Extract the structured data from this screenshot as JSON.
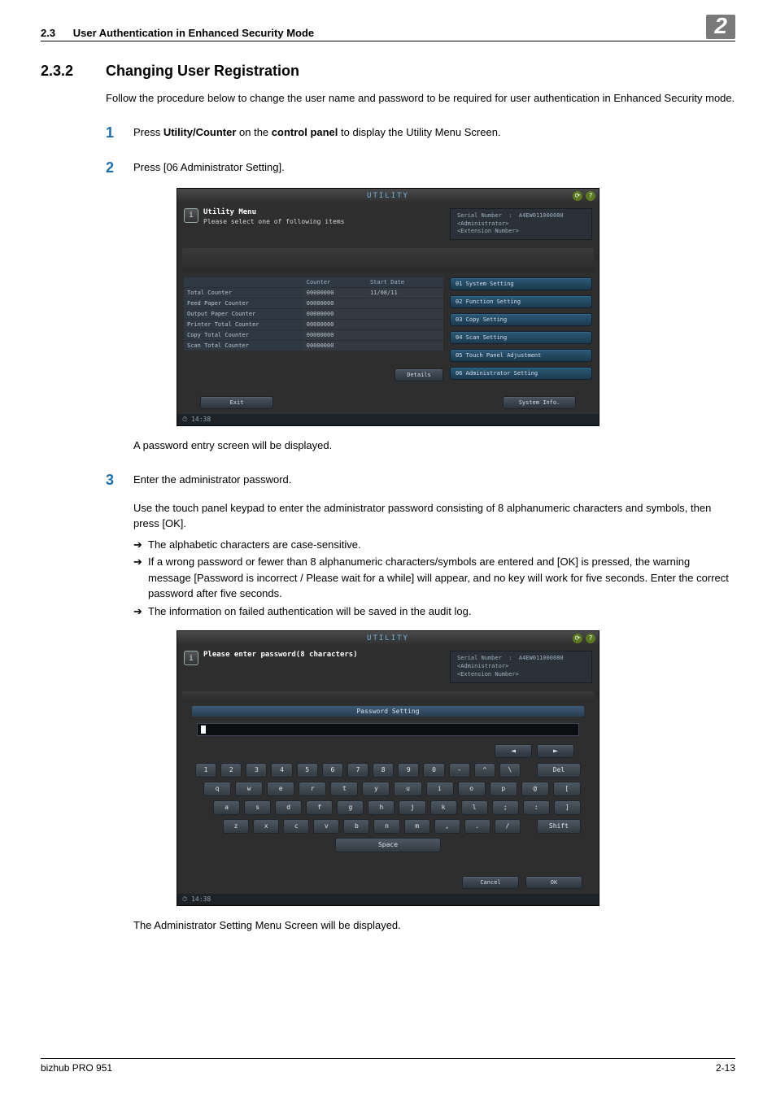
{
  "header": {
    "section_number": "2.3",
    "section_title": "User Authentication in Enhanced Security Mode",
    "chapter": "2"
  },
  "section": {
    "subnum": "2.3.2",
    "title": "Changing User Registration",
    "intro": "Follow the procedure below to change the user name and password to be required for user authentication in Enhanced Security mode."
  },
  "steps": {
    "s1": {
      "num": "1",
      "before": "Press ",
      "bold1": "Utility/Counter",
      "mid": " on the ",
      "bold2": "control panel",
      "after": " to display the Utility Menu Screen."
    },
    "s2": {
      "num": "2",
      "text": "Press [06 Administrator Setting]."
    },
    "s2_after": "A password entry screen will be displayed.",
    "s3": {
      "num": "3",
      "line1": "Enter the administrator password.",
      "para": "Use the touch panel keypad to enter the administrator password consisting of 8 alphanumeric characters and symbols, then press [OK].",
      "b1": "The alphabetic characters are case-sensitive.",
      "b2": "If a wrong password or fewer than 8 alphanumeric characters/symbols are entered and [OK] is pressed, the warning message [Password is incorrect / Please wait for a while] will appear, and no key will work for five seconds. Enter the correct password after five seconds.",
      "b3": "The information on failed authentication will be saved in the audit log."
    },
    "after_shot2": "The Administrator Setting Menu Screen will be displayed."
  },
  "shot1": {
    "title": "UTILITY",
    "menu_label": "Utility Menu",
    "menu_sub": "Please select one of following items",
    "serial_label": "Serial Number",
    "serial_value": "A4EW011000080",
    "admin_label": "<Administrator>",
    "ext_label": "<Extension Number>",
    "col_counter": "Counter",
    "col_start": "Start Date",
    "rows": [
      {
        "label": "Total Counter",
        "counter": "00000000",
        "start": "11/08/11"
      },
      {
        "label": "Feed Paper Counter",
        "counter": "00000000",
        "start": ""
      },
      {
        "label": "Output Paper Counter",
        "counter": "00000000",
        "start": ""
      },
      {
        "label": "Printer Total Counter",
        "counter": "00000000",
        "start": ""
      },
      {
        "label": "Copy Total Counter",
        "counter": "00000000",
        "start": ""
      },
      {
        "label": "Scan Total Counter",
        "counter": "00000000",
        "start": ""
      }
    ],
    "details": "Details",
    "menu": {
      "m1": "01 System Setting",
      "m2": "02 Function Setting",
      "m3": "03 Copy Setting",
      "m4": "04 Scan Setting",
      "m5": "05 Touch Panel Adjustment",
      "m6": "06 Administrator Setting"
    },
    "exit": "Exit",
    "sysinfo": "System Info.",
    "clock": "14:38"
  },
  "shot2": {
    "title": "UTILITY",
    "prompt": "Please enter password(8 characters)",
    "serial_label": "Serial Number",
    "serial_value": "A4EW011000080",
    "admin_label": "<Administrator>",
    "ext_label": "<Extension Number>",
    "ribbon": "Password Setting",
    "arrow_left": "◄",
    "arrow_right": "►",
    "del": "Del",
    "shift": "Shift",
    "space": "Space",
    "cancel": "Cancel",
    "ok": "OK",
    "clock": "14:38",
    "row1": [
      "1",
      "2",
      "3",
      "4",
      "5",
      "6",
      "7",
      "8",
      "9",
      "0",
      "-",
      "^",
      "\\"
    ],
    "row2": [
      "q",
      "w",
      "e",
      "r",
      "t",
      "y",
      "u",
      "i",
      "o",
      "p",
      "@",
      "["
    ],
    "row3": [
      "a",
      "s",
      "d",
      "f",
      "g",
      "h",
      "j",
      "k",
      "l",
      ";",
      ":",
      "]"
    ],
    "row4": [
      "z",
      "x",
      "c",
      "v",
      "b",
      "n",
      "m",
      ",",
      ".",
      "/"
    ]
  },
  "footer": {
    "product": "bizhub PRO 951",
    "page": "2-13"
  }
}
